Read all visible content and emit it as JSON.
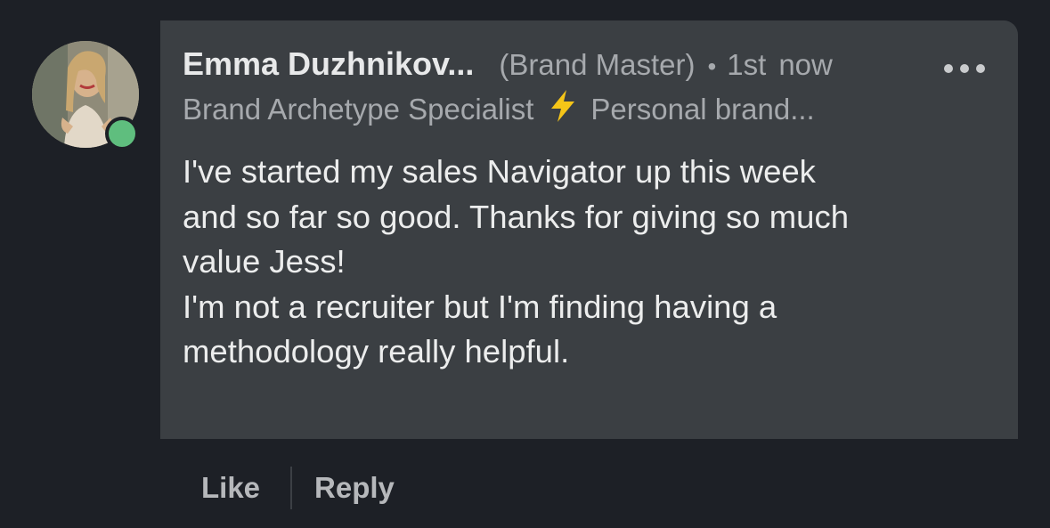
{
  "comment": {
    "author": {
      "name": "Emma Duzhnikov...",
      "badge": "(Brand Master)",
      "degree": "1st",
      "headline_part1": "Brand Archetype Specialist",
      "headline_emoji_icon": "lightning-bolt-icon",
      "headline_part2": "Personal brand...",
      "online": true
    },
    "timestamp": "now",
    "meta_separator": "•",
    "more_icon": "ellipsis-icon",
    "body_lines": [
      "I've started my sales Navigator up this week",
      "and so far so good. Thanks for giving so much",
      "value Jess!",
      "I'm not a recruiter but I'm finding having a",
      "methodology really helpful."
    ]
  },
  "actions": {
    "like_label": "Like",
    "reply_label": "Reply"
  },
  "colors": {
    "background": "#1d2026",
    "bubble": "#3b3f43",
    "presence": "#5fbe7e",
    "bolt": "#f5c518"
  }
}
